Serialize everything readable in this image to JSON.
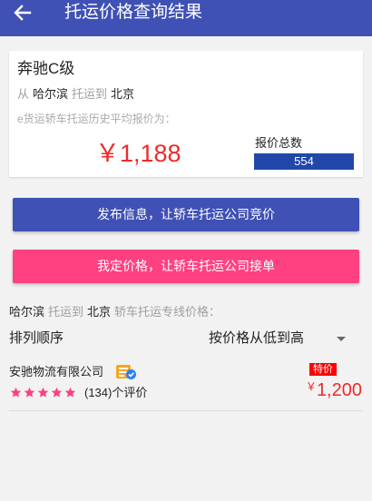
{
  "header": {
    "title": "托运价格查询结果",
    "back_icon": "arrow-left-icon"
  },
  "summary": {
    "car_model": "奔驰C级",
    "from_label": "从",
    "origin": "哈尔滨",
    "to_label": "托运到",
    "destination": "北京",
    "avg_note": "e货运轿车托运历史平均报价为：",
    "currency": "￥",
    "avg_price": "1,188",
    "total_label": "报价总数",
    "total_count": "554"
  },
  "actions": {
    "publish_label": "发布信息，让轿车托运公司竞价",
    "fixed_price_label": "我定价格，让轿车托运公司接单"
  },
  "route_heading": {
    "origin": "哈尔滨",
    "to_label": "托运到",
    "destination": "北京",
    "suffix": "轿车托运专线价格："
  },
  "sort": {
    "label": "排列顺序",
    "selected": "按价格从低到高",
    "icon": "dropdown-arrow-icon"
  },
  "companies": [
    {
      "name": "安驰物流有限公司",
      "icon": "certified-company-icon",
      "rating": 5,
      "reviews": "(134)个评价",
      "badge": "特价",
      "currency": "￥",
      "price": "1,200"
    }
  ],
  "colors": {
    "primary": "#3f51b5",
    "accent": "#ff4081",
    "price_red": "#f02a2a",
    "badge_red": "#ff0000",
    "count_bar": "#2147a9"
  }
}
